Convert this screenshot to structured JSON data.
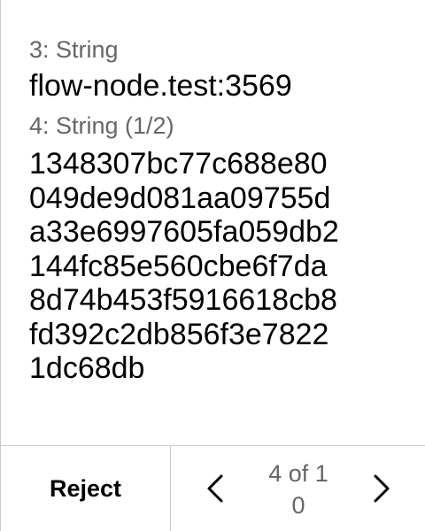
{
  "fields": [
    {
      "label": "3: String",
      "value": "flow-node.test:3569"
    },
    {
      "label": "4: String (1/2)",
      "value_lines": [
        "1348307bc77c688e80",
        "049de9d081aa09755d",
        "a33e6997605fa059db2",
        "144fc85e560cbe6f7da",
        "8d74b453f5916618cb8",
        "fd392c2db856f3e7822",
        "1dc68db"
      ]
    }
  ],
  "footer": {
    "reject_label": "Reject",
    "page_indicator_line1": "4 of 1",
    "page_indicator_line2": "0",
    "prev_icon": "chevron-left-icon",
    "next_icon": "chevron-right-icon"
  },
  "colors": {
    "text": "#000000",
    "label": "#666666",
    "divider": "#c9c9c9",
    "background": "#ffffff"
  }
}
